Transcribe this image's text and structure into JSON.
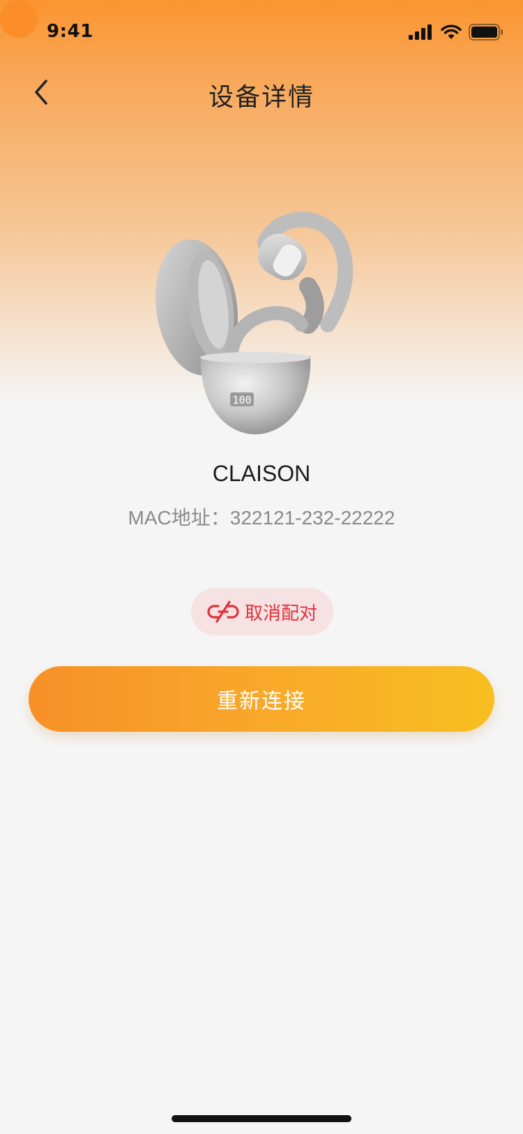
{
  "status_bar": {
    "time": "9:41",
    "icons": [
      "signal-icon",
      "wifi-icon",
      "battery-icon"
    ]
  },
  "nav": {
    "title": "设备详情",
    "back_icon": "chevron-left-icon"
  },
  "device": {
    "name": "CLAISON",
    "mac_label": "MAC地址：",
    "mac_value": "322121-232-22222",
    "case_display": "100"
  },
  "actions": {
    "unpair_label": "取消配对",
    "unpair_icon": "unlink-icon",
    "reconnect_label": "重新连接"
  },
  "colors": {
    "accent_start": "#f79027",
    "accent_end": "#f8bf20",
    "danger": "#e0323a",
    "danger_bg": "#f6e2e3"
  }
}
